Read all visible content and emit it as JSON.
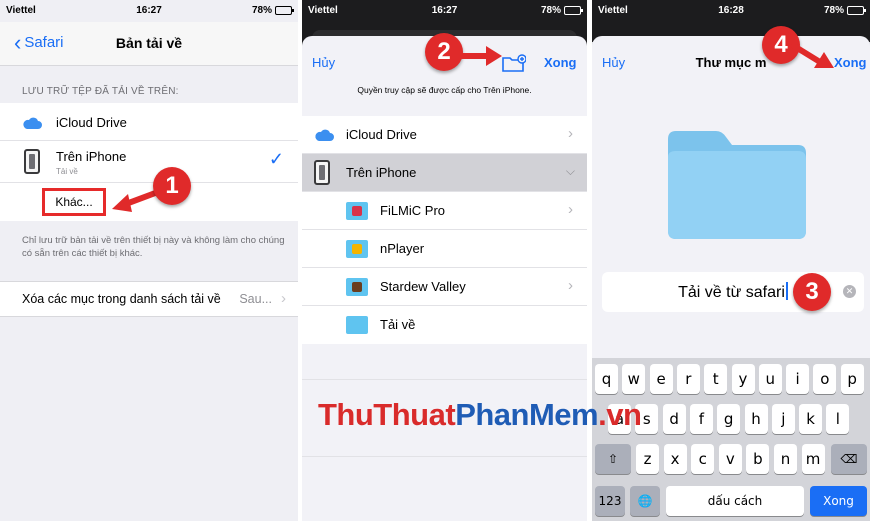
{
  "status": {
    "p1": {
      "carrier": "Viettel",
      "time": "16:27",
      "battery": "78%"
    },
    "p2": {
      "carrier": "Viettel",
      "time": "16:27",
      "battery": "78%"
    },
    "p3": {
      "carrier": "Viettel",
      "time": "16:28",
      "battery": "78%"
    }
  },
  "panel1": {
    "back_label": "Safari",
    "title": "Bản tải về",
    "section_header": "LƯU TRỮ TỆP ĐÃ TẢI VỀ TRÊN:",
    "icloud_label": "iCloud Drive",
    "iphone_label": "Trên iPhone",
    "iphone_sub": "Tải về",
    "other_label": "Khác...",
    "footnote": "Chỉ lưu trữ bản tải về trên thiết bị này và không làm cho chúng có sẵn trên các thiết bị khác.",
    "clear_label": "Xóa các mục trong danh sách tải về",
    "clear_value": "Sau..."
  },
  "panel2": {
    "cancel_label": "Hủy",
    "done_label": "Xong",
    "access_note": "Quyền truy cập sẽ được cấp cho Trên iPhone.",
    "locations": [
      {
        "label": "iCloud Drive"
      },
      {
        "label": "Trên iPhone"
      }
    ],
    "folders": [
      {
        "label": "FiLMiC Pro",
        "icon": "filmic-icon",
        "color": "#d8334a"
      },
      {
        "label": "nPlayer",
        "icon": "nplayer-icon",
        "color": "#f4b400"
      },
      {
        "label": "Stardew Valley",
        "icon": "stardew-icon",
        "color": "#6a3d1e"
      },
      {
        "label": "Tải về",
        "icon": "download-folder-icon",
        "color": "#5fc4f0"
      }
    ]
  },
  "panel3": {
    "cancel_label": "Hủy",
    "title": "Thư mục m",
    "done_label": "Xong",
    "folder_name": "Tải về từ safari",
    "keys_row1": [
      "q",
      "w",
      "e",
      "r",
      "t",
      "y",
      "u",
      "i",
      "o",
      "p"
    ],
    "keys_row2": [
      "a",
      "s",
      "d",
      "f",
      "g",
      "h",
      "j",
      "k",
      "l"
    ],
    "keys_row3": [
      "z",
      "x",
      "c",
      "v",
      "b",
      "n",
      "m"
    ],
    "key_numbers": "123",
    "key_space": "dấu cách",
    "key_go": "Xong"
  },
  "steps": [
    "1",
    "2",
    "3",
    "4"
  ],
  "watermark": {
    "part1": "ThuThuat",
    "part2": "PhanMem",
    "part3": ".vn"
  },
  "colors": {
    "accent": "#1a6ef5",
    "highlight": "#e02a2a"
  }
}
